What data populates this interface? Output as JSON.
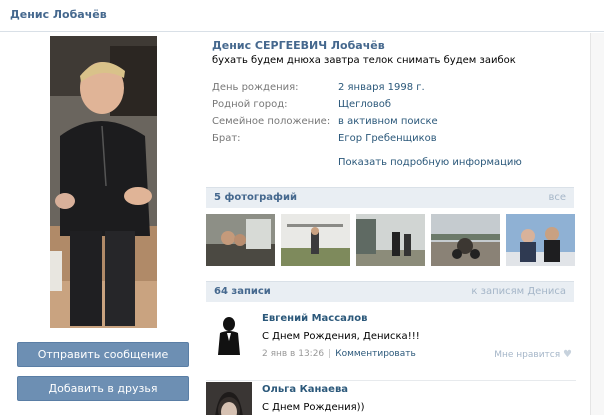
{
  "page": {
    "title": "Денис Лобачёв"
  },
  "profile": {
    "name": "Денис СЕРГЕЕВИЧ Лобачёв",
    "status": "бухать будем днюха завтра телок снимать будем заибок",
    "info": [
      {
        "label": "День рождения:",
        "value": "2 января 1998 г."
      },
      {
        "label": "Родной город:",
        "value": "Щегловоб"
      },
      {
        "label": "Семейное положение:",
        "value": "в активном поиске"
      },
      {
        "label": "Брат:",
        "value": "Егор Гребенщиков"
      }
    ],
    "more_link": "Показать подробную информацию"
  },
  "actions": {
    "send_message": "Отправить сообщение",
    "add_friend": "Добавить в друзья"
  },
  "photos": {
    "header": "5 фотографий",
    "all_link": "все"
  },
  "wall": {
    "header": "64 записи",
    "to_wall_link": "к записям Дениса",
    "posts": [
      {
        "author": "Евгений Массалов",
        "text": "С Днем Рождения, Дениска!!!",
        "time": "2 янв в 13:26",
        "comment": "Комментировать",
        "like": "Мне нравится"
      },
      {
        "author": "Ольга Канаева",
        "text": "С Днем Рождения))"
      }
    ]
  },
  "colors": {
    "link": "#2b587a",
    "header_text": "#45688e",
    "button": "#6d8fb3",
    "section_bg": "#e9eef3"
  }
}
